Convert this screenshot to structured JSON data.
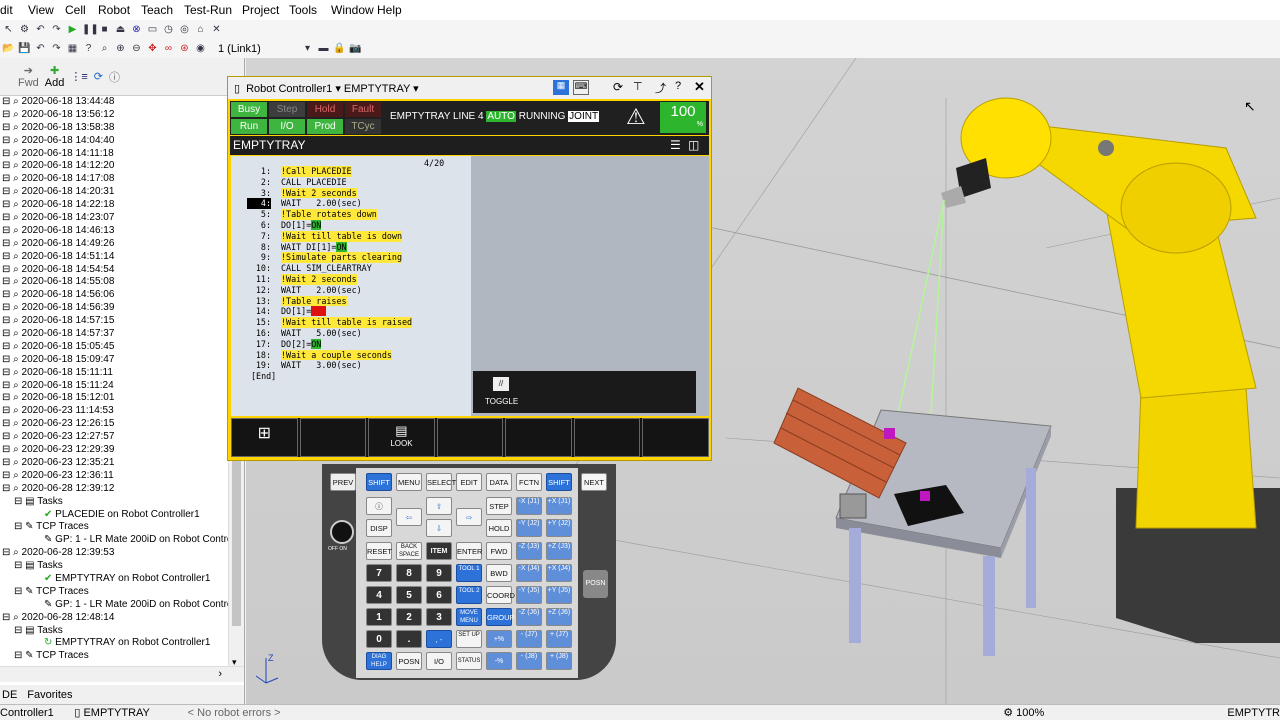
{
  "menu": [
    "dit",
    "View",
    "Cell",
    "Robot",
    "Teach",
    "Test-Run",
    "Project",
    "Tools",
    "Window",
    "Help"
  ],
  "toolbar": {
    "link_select": "1 (Link1)"
  },
  "left_panel": {
    "fwd": "Fwd",
    "add": "Add"
  },
  "tree": [
    "2020-06-18 13:44:48",
    "2020-06-18 13:56:12",
    "2020-06-18 13:58:38",
    "2020-06-18 14:04:40",
    "2020-06-18 14:11:18",
    "2020-06-18 14:12:20",
    "2020-06-18 14:17:08",
    "2020-06-18 14:20:31",
    "2020-06-18 14:22:18",
    "2020-06-18 14:23:07",
    "2020-06-18 14:46:13",
    "2020-06-18 14:49:26",
    "2020-06-18 14:51:14",
    "2020-06-18 14:54:54",
    "2020-06-18 14:55:08",
    "2020-06-18 14:56:06",
    "2020-06-18 14:56:39",
    "2020-06-18 14:57:15",
    "2020-06-18 14:57:37",
    "2020-06-18 15:05:45",
    "2020-06-18 15:09:47",
    "2020-06-18 15:11:11",
    "2020-06-18 15:11:24",
    "2020-06-18 15:12:01",
    "2020-06-23 11:14:53",
    "2020-06-23 12:26:15",
    "2020-06-23 12:27:57",
    "2020-06-23 12:29:39",
    "2020-06-23 12:35:21",
    "2020-06-23 12:36:11",
    "2020-06-28 12:39:12",
    "Tasks",
    "PLACEDIE on Robot Controller1",
    "TCP Traces",
    "GP: 1 - LR Mate 200iD on Robot Control",
    "2020-06-28 12:39:53",
    "Tasks",
    "EMPTYTRAY on Robot Controller1",
    "TCP Traces",
    "GP: 1 - LR Mate 200iD on Robot Control",
    "2020-06-28 12:48:14",
    "Tasks",
    "EMPTYTRAY on Robot Controller1",
    "TCP Traces"
  ],
  "left_tabs": [
    "DE",
    "Favorites"
  ],
  "tp": {
    "title": "Robot Controller1 ▾  EMPTYTRAY ▾",
    "status": {
      "busy": "Busy",
      "step": "Step",
      "hold": "Hold",
      "fault": "Fault",
      "run": "Run",
      "io": "I/O",
      "prod": "Prod",
      "tcyc": "TCyc"
    },
    "line_text": "EMPTYTRAY LINE 4",
    "auto": "AUTO",
    "running": "RUNNING",
    "joint": "JOINT",
    "speed": "100",
    "speed_unit": "%",
    "header": "EMPTYTRAY",
    "counter": "4/20",
    "lines": [
      {
        "n": "1:",
        "t": "!Call PLACEDIE",
        "hl": true
      },
      {
        "n": "2:",
        "t": "CALL PLACEDIE",
        "hl": false
      },
      {
        "n": "3:",
        "t": "!Wait 2 seconds",
        "hl": true
      },
      {
        "n": "4:",
        "t": "WAIT   2.00(sec)",
        "hl": false
      },
      {
        "n": "5:",
        "t": "!Table rotates down",
        "hl": true
      },
      {
        "n": "6:",
        "t": "DO[1]=ON",
        "hl": false
      },
      {
        "n": "7:",
        "t": "!Wait till table is down",
        "hl": true
      },
      {
        "n": "8:",
        "t": "WAIT DI[1]=ON",
        "hl": false
      },
      {
        "n": "9:",
        "t": "!Simulate parts clearing",
        "hl": true
      },
      {
        "n": "10:",
        "t": "CALL SIM_CLEARTRAY",
        "hl": false
      },
      {
        "n": "11:",
        "t": "!Wait 2 seconds",
        "hl": true
      },
      {
        "n": "12:",
        "t": "WAIT   2.00(sec)",
        "hl": false
      },
      {
        "n": "13:",
        "t": "!Table raises",
        "hl": true
      },
      {
        "n": "14:",
        "t": "DO[1]=OFF",
        "hl": false
      },
      {
        "n": "15:",
        "t": "!Wait till table is raised",
        "hl": true
      },
      {
        "n": "16:",
        "t": "WAIT   5.00(sec)",
        "hl": false
      },
      {
        "n": "17:",
        "t": "DO[2]=ON",
        "hl": false
      },
      {
        "n": "18:",
        "t": "!Wait a couple seconds",
        "hl": true
      },
      {
        "n": "19:",
        "t": "WAIT   3.00(sec)",
        "hl": false
      },
      {
        "n": "",
        "t": "[End]",
        "hl": false
      }
    ],
    "toggle": "TOGGLE",
    "look": "LOOK"
  },
  "keys": {
    "prev": "PREV",
    "shift": "SHIFT",
    "menu": "MENU",
    "select": "SELECT",
    "edit": "EDIT",
    "data": "DATA",
    "fctn": "FCTN",
    "next": "NEXT",
    "disp": "DISP",
    "step": "STEP",
    "hold": "HOLD",
    "fwd": "FWD",
    "bwd": "BWD",
    "coord": "COORD",
    "group": "GROUP",
    "reset": "RESET",
    "backspace": "BACK SPACE",
    "item": "ITEM",
    "enter": "ENTER",
    "tool1": "TOOL 1",
    "tool2": "TOOL 2",
    "move_menu": "MOVE MENU",
    "setup": "SET UP",
    "diag": "DIAG HELP",
    "posn": "POSN",
    "io": "I/O",
    "status": "STATUS",
    "posn_side": "POSN",
    "off_on": "OFF ON"
  },
  "status_bar": {
    "controller": "Controller1",
    "program": "EMPTYTRAY",
    "errors": "< No robot errors >",
    "zoom": "100%",
    "right": "EMPTYTR"
  }
}
